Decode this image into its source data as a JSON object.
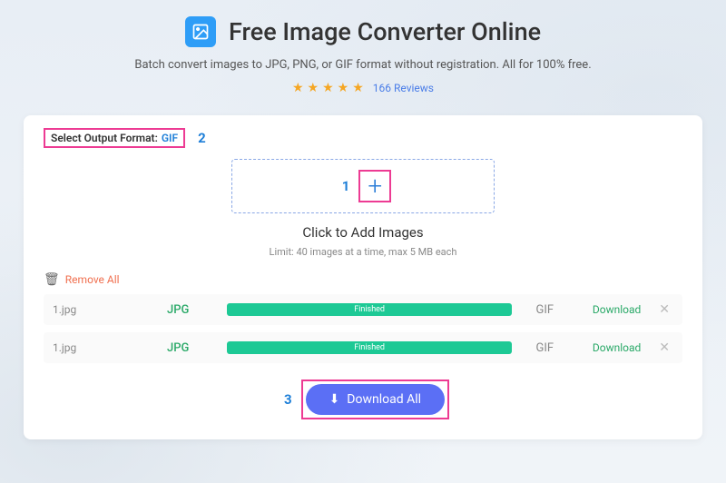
{
  "header": {
    "title": "Free Image Converter Online",
    "subtitle": "Batch convert images to JPG, PNG, or GIF format without registration. All for 100% free.",
    "reviews_text": "166 Reviews"
  },
  "format": {
    "label": "Select Output Format:",
    "value": "GIF"
  },
  "steps": {
    "one": "1",
    "two": "2",
    "three": "3"
  },
  "dropzone": {
    "add_text": "Click to Add Images",
    "limit": "Limit: 40 images at a time, max 5 MB each"
  },
  "remove_all": "Remove All",
  "files": [
    {
      "name": "1.jpg",
      "src": "JPG",
      "status": "Finished",
      "dst": "GIF",
      "action": "Download"
    },
    {
      "name": "1.jpg",
      "src": "JPG",
      "status": "Finished",
      "dst": "GIF",
      "action": "Download"
    }
  ],
  "download_all": "Download All"
}
